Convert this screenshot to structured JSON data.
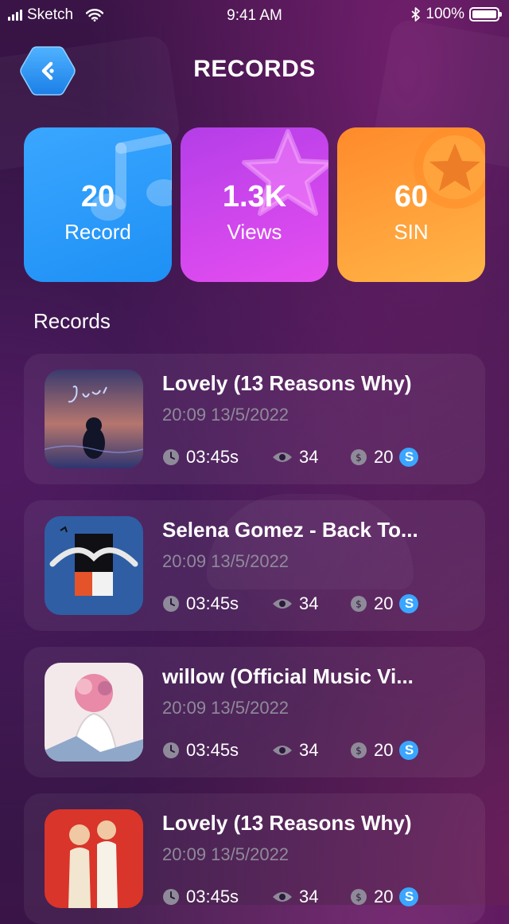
{
  "status_bar": {
    "carrier": "Sketch",
    "time": "9:41 AM",
    "battery": "100%"
  },
  "header": {
    "title": "RECORDS"
  },
  "stats": [
    {
      "value": "20",
      "label": "Record"
    },
    {
      "value": "1.3K",
      "label": "Views"
    },
    {
      "value": "60",
      "label": "SIN"
    }
  ],
  "section_title": "Records",
  "records": [
    {
      "title": "Lovely (13 Reasons Why)",
      "date": "20:09 13/5/2022",
      "duration": "03:45s",
      "views": "34",
      "coins": "20",
      "coin_badge": "S"
    },
    {
      "title": "Selena Gomez - Back To...",
      "date": "20:09 13/5/2022",
      "duration": "03:45s",
      "views": "34",
      "coins": "20",
      "coin_badge": "S"
    },
    {
      "title": "willow (Official Music Vi...",
      "date": "20:09 13/5/2022",
      "duration": "03:45s",
      "views": "34",
      "coins": "20",
      "coin_badge": "S"
    },
    {
      "title": "Lovely (13 Reasons Why)",
      "date": "20:09 13/5/2022",
      "duration": "03:45s",
      "views": "34",
      "coins": "20",
      "coin_badge": "S"
    }
  ],
  "colors": {
    "record_card": "#2196f3",
    "views_card": "#d046ee",
    "sin_card": "#ffa03a",
    "coin_badge": "#3aa6ff",
    "date_text": "#8f8a99"
  }
}
